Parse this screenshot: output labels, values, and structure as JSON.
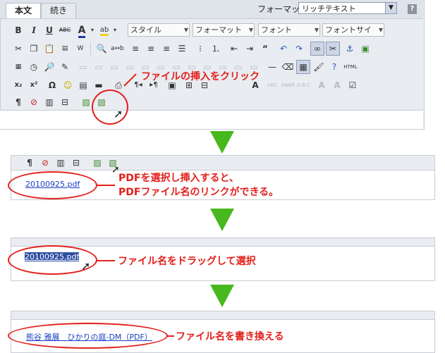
{
  "tabs": [
    "本文",
    "続き"
  ],
  "format": {
    "label": "フォーマット:",
    "value": "リッチテキスト",
    "help": "?"
  },
  "toolbar": {
    "style_dd": "スタイル",
    "format_dd": "フォーマット",
    "font_dd": "フォント",
    "size_dd": "フォントサイ"
  },
  "callouts": {
    "step1": "ファイルの挿入をクリック",
    "step2_line1": "PDFを選択し挿入すると、",
    "step2_line2": "PDFファイル名のリンクができる。",
    "step3": "ファイル名をドラッグして選択",
    "step4": "ファイル名を書き換える"
  },
  "links": {
    "filename": "20100925.pdf",
    "renamed": "熊谷 雅展　ひかりの庭-DM（PDF）"
  },
  "colors": {
    "accent_red": "#e3201b",
    "arrow_green": "#47b81e",
    "link_blue": "#1a3fc4"
  }
}
